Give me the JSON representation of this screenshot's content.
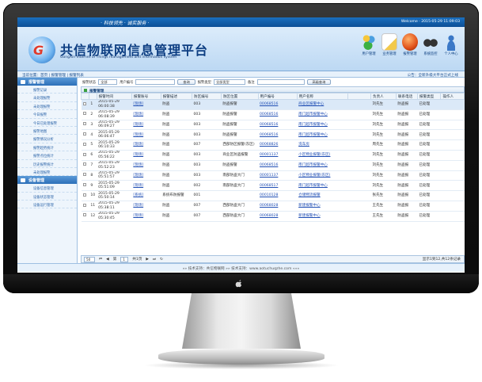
{
  "topbar": {
    "slogan": "· 科技领先 · 诚实服务 ·",
    "time": "Welcome · 2015-05-29 11:09:03"
  },
  "header": {
    "title": "共信物联网信息管理平台",
    "subtitle": "GongXin Internet of Things management and information system",
    "logo_text": "G",
    "tools": [
      {
        "icon": "users-icon",
        "label": "用户管理"
      },
      {
        "icon": "note-icon",
        "label": "业务管理"
      },
      {
        "icon": "dome-icon",
        "label": "报警管理"
      },
      {
        "icon": "binoculars-icon",
        "label": "系统监控"
      },
      {
        "icon": "person-icon",
        "label": "个人中心"
      }
    ]
  },
  "nav": {
    "left": "当前位置：首页 | 报警管理 | 报警列表",
    "right": "公告：全新升级大平台正式上线"
  },
  "sidebar": {
    "group1": "报警管理",
    "items1": [
      "报警记录",
      "未处理报警",
      "未处理报警",
      "今日报警",
      "今日已处理报警",
      "报警地图",
      "报警情况分析",
      "报警趋势统计",
      "报警点位统计",
      "历史报警统计",
      "未处理报警"
    ],
    "group2": "设备管理",
    "items2": [
      "设备信息管理",
      "设备状态管理",
      "设备运行管理"
    ]
  },
  "search": {
    "label1": "报警状态",
    "sel1": "全部",
    "label2": "用户编号",
    "btn1": "查询",
    "label3": "报警类型",
    "sel2": "全部类型",
    "label4": "备注",
    "btn2": "高级查询"
  },
  "grid": {
    "title": "报警管理",
    "columns": [
      "",
      "",
      "报警时间",
      "报警账号",
      "报警描述",
      "防区编号",
      "防区位置",
      "用户编号",
      "用户名称",
      "",
      "负责人",
      "联系电话",
      "报警类型",
      "操作人"
    ],
    "rows": [
      [
        "1",
        "2015-05-29 06:00:38",
        "[现场]",
        "防盗",
        "003",
        "防盗报警",
        "00068516",
        "商业区报警中心",
        "",
        "刘先生",
        "防盗报",
        "已处理",
        ""
      ],
      [
        "2",
        "2015-05-29 06:08:39",
        "[现场]",
        "防盗",
        "003",
        "防盗报警",
        "00068516",
        "南门超市报警中心",
        "",
        "刘先生",
        "防盗报",
        "已处理",
        ""
      ],
      [
        "3",
        "2015-05-29 06:09:27",
        "[现场]",
        "防盗",
        "003",
        "防盗报警",
        "00068516",
        "南门超市报警中心",
        "",
        "刘先生",
        "防盗报",
        "已处理",
        ""
      ],
      [
        "4",
        "2015-05-29 06:06:47",
        "[现场]",
        "防盗",
        "003",
        "防盗报警",
        "00068516",
        "南门超市报警中心",
        "",
        "刘先生",
        "防盗报",
        "已处理",
        ""
      ],
      [
        "5",
        "2015-05-29 06:10:33",
        "[现场]",
        "防盗",
        "007",
        "西部防区报警(东区)",
        "00068826",
        "洗车房",
        "",
        "周先生",
        "防盗报",
        "已处理",
        ""
      ],
      [
        "6",
        "2015-05-29 05:56:22",
        "[现场]",
        "防盗",
        "003",
        "商业区防盗报警",
        "00001137",
        "小区物业报警(东区)",
        "",
        "刘先生",
        "防盗报",
        "已处理",
        ""
      ],
      [
        "7",
        "2015-05-29 05:52:23",
        "[现场]",
        "防盗",
        "003",
        "防盗报警",
        "00068516",
        "南门超市报警中心",
        "",
        "刘先生",
        "防盗报",
        "已处理",
        ""
      ],
      [
        "8",
        "2015-05-29 05:51:57",
        "[现场]",
        "防盗",
        "003",
        "南部防盗大门",
        "00001137",
        "小区物业报警(东区)",
        "",
        "刘先生",
        "防盗报",
        "已处理",
        ""
      ],
      [
        "9",
        "2015-05-29 05:51:09",
        "[现场]",
        "防盗",
        "002",
        "南部防盗大门",
        "00068517",
        "南门超市报警中心",
        "",
        "刘先生",
        "防盗报",
        "已处理",
        ""
      ],
      [
        "10",
        "2015-05-29 05:50:14",
        "[系统]",
        "系统布防报警",
        "001",
        "",
        "00010128",
        "仓储物流报警",
        "",
        "张先生",
        "防盗报",
        "已处理",
        ""
      ],
      [
        "11",
        "2015-05-29 05:38:11",
        "[现场]",
        "防盗",
        "007",
        "西部防盗大门",
        "00068028",
        "新建报警中心",
        "",
        "王先生",
        "防盗报",
        "已处理",
        ""
      ],
      [
        "12",
        "2015-05-29 05:30:45",
        "[现场]",
        "防盗",
        "007",
        "西部防盗大门",
        "00068028",
        "新建报警中心",
        "",
        "王先生",
        "防盗报",
        "已处理",
        ""
      ]
    ]
  },
  "pager": {
    "size": "50",
    "page_label": "第",
    "page": "1",
    "of": "共1页",
    "info": "显示1到12,共12条记录"
  },
  "footer": "»» 技术支持：共信物联网 »» 技术支持：www.aotuchuqzhe.com «««"
}
